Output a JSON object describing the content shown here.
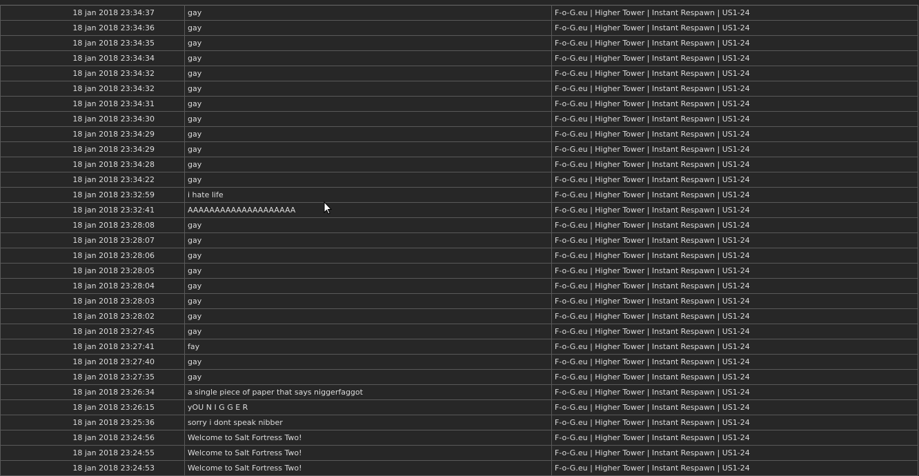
{
  "rows": [
    {
      "time": "18 jan 2018 23:34:37",
      "message": "gay",
      "server": "F-o-G.eu | Higher Tower | Instant Respawn | US1-24"
    },
    {
      "time": "18 jan 2018 23:34:36",
      "message": "gay",
      "server": "F-o-G.eu | Higher Tower | Instant Respawn | US1-24"
    },
    {
      "time": "18 jan 2018 23:34:35",
      "message": "gay",
      "server": "F-o-G.eu | Higher Tower | Instant Respawn | US1-24"
    },
    {
      "time": "18 jan 2018 23:34:34",
      "message": "gay",
      "server": "F-o-G.eu | Higher Tower | Instant Respawn | US1-24"
    },
    {
      "time": "18 jan 2018 23:34:32",
      "message": "gay",
      "server": "F-o-G.eu | Higher Tower | Instant Respawn | US1-24"
    },
    {
      "time": "18 jan 2018 23:34:32",
      "message": "gay",
      "server": "F-o-G.eu | Higher Tower | Instant Respawn | US1-24"
    },
    {
      "time": "18 jan 2018 23:34:31",
      "message": "gay",
      "server": "F-o-G.eu | Higher Tower | Instant Respawn | US1-24"
    },
    {
      "time": "18 jan 2018 23:34:30",
      "message": "gay",
      "server": "F-o-G.eu | Higher Tower | Instant Respawn | US1-24"
    },
    {
      "time": "18 jan 2018 23:34:29",
      "message": "gay",
      "server": "F-o-G.eu | Higher Tower | Instant Respawn | US1-24"
    },
    {
      "time": "18 jan 2018 23:34:29",
      "message": "gay",
      "server": "F-o-G.eu | Higher Tower | Instant Respawn | US1-24"
    },
    {
      "time": "18 jan 2018 23:34:28",
      "message": "gay",
      "server": "F-o-G.eu | Higher Tower | Instant Respawn | US1-24"
    },
    {
      "time": "18 jan 2018 23:34:22",
      "message": "gay",
      "server": "F-o-G.eu | Higher Tower | Instant Respawn | US1-24"
    },
    {
      "time": "18 jan 2018 23:32:59",
      "message": "i hate life",
      "server": "F-o-G.eu | Higher Tower | Instant Respawn | US1-24"
    },
    {
      "time": "18 jan 2018 23:32:41",
      "message": "AAAAAAAAAAAAAAAAAAAA",
      "server": "F-o-G.eu | Higher Tower | Instant Respawn | US1-24"
    },
    {
      "time": "18 jan 2018 23:28:08",
      "message": "gay",
      "server": "F-o-G.eu | Higher Tower | Instant Respawn | US1-24"
    },
    {
      "time": "18 jan 2018 23:28:07",
      "message": "gay",
      "server": "F-o-G.eu | Higher Tower | Instant Respawn | US1-24"
    },
    {
      "time": "18 jan 2018 23:28:06",
      "message": "gay",
      "server": "F-o-G.eu | Higher Tower | Instant Respawn | US1-24"
    },
    {
      "time": "18 jan 2018 23:28:05",
      "message": "gay",
      "server": "F-o-G.eu | Higher Tower | Instant Respawn | US1-24"
    },
    {
      "time": "18 jan 2018 23:28:04",
      "message": "gay",
      "server": "F-o-G.eu | Higher Tower | Instant Respawn | US1-24"
    },
    {
      "time": "18 jan 2018 23:28:03",
      "message": "gay",
      "server": "F-o-G.eu | Higher Tower | Instant Respawn | US1-24"
    },
    {
      "time": "18 jan 2018 23:28:02",
      "message": "gay",
      "server": "F-o-G.eu | Higher Tower | Instant Respawn | US1-24"
    },
    {
      "time": "18 jan 2018 23:27:45",
      "message": "gay",
      "server": "F-o-G.eu | Higher Tower | Instant Respawn | US1-24"
    },
    {
      "time": "18 jan 2018 23:27:41",
      "message": "fay",
      "server": "F-o-G.eu | Higher Tower | Instant Respawn | US1-24"
    },
    {
      "time": "18 jan 2018 23:27:40",
      "message": "gay",
      "server": "F-o-G.eu | Higher Tower | Instant Respawn | US1-24"
    },
    {
      "time": "18 jan 2018 23:27:35",
      "message": "gay",
      "server": "F-o-G.eu | Higher Tower | Instant Respawn | US1-24"
    },
    {
      "time": "18 jan 2018 23:26:34",
      "message": "a single piece of paper that says niggerfaggot",
      "server": "F-o-G.eu | Higher Tower | Instant Respawn | US1-24"
    },
    {
      "time": "18 jan 2018 23:26:15",
      "message": "yOU N I G G E R",
      "server": "F-o-G.eu | Higher Tower | Instant Respawn | US1-24"
    },
    {
      "time": "18 jan 2018 23:25:36",
      "message": "sorry i dont speak nibber",
      "server": "F-o-G.eu | Higher Tower | Instant Respawn | US1-24"
    },
    {
      "time": "18 jan 2018 23:24:56",
      "message": "Welcome to Salt Fortress Two!",
      "server": "F-o-G.eu | Higher Tower | Instant Respawn | US1-24"
    },
    {
      "time": "18 jan 2018 23:24:55",
      "message": "Welcome to Salt Fortress Two!",
      "server": "F-o-G.eu | Higher Tower | Instant Respawn | US1-24"
    },
    {
      "time": "18 jan 2018 23:24:53",
      "message": "Welcome to Salt Fortress Two!",
      "server": "F-o-G.eu | Higher Tower | Instant Respawn | US1-24"
    }
  ],
  "cursor": {
    "icon": "mouse-pointer-icon"
  }
}
